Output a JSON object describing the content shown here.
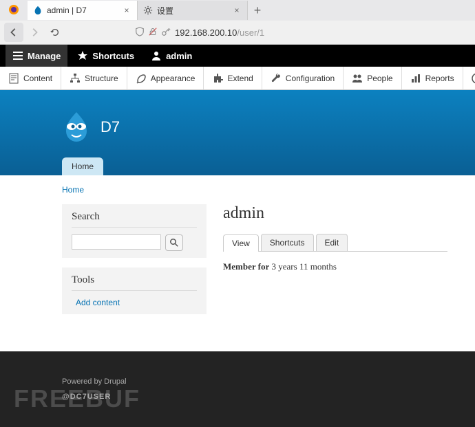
{
  "browser": {
    "tabs": [
      {
        "title": "admin | D7",
        "active": true
      },
      {
        "title": "设置",
        "active": false
      }
    ],
    "url_host": "192.168.200.10",
    "url_path": "/user/1"
  },
  "admin_bar": {
    "manage": "Manage",
    "shortcuts": "Shortcuts",
    "user": "admin"
  },
  "admin_menu": [
    "Content",
    "Structure",
    "Appearance",
    "Extend",
    "Configuration",
    "People",
    "Reports",
    "Help"
  ],
  "site": {
    "name": "D7",
    "primary_tab": "Home",
    "breadcrumb": "Home"
  },
  "sidebar": {
    "search_title": "Search",
    "search_placeholder": "",
    "tools_title": "Tools",
    "add_content": "Add content"
  },
  "main": {
    "title": "admin",
    "tabs": {
      "view": "View",
      "shortcuts": "Shortcuts",
      "edit": "Edit"
    },
    "member_label": "Member for",
    "member_duration": "3 years 11 months"
  },
  "footer": {
    "powered": "Powered by Drupal",
    "watermark": "FREEBUF",
    "user_tag": "@DC7USER"
  }
}
